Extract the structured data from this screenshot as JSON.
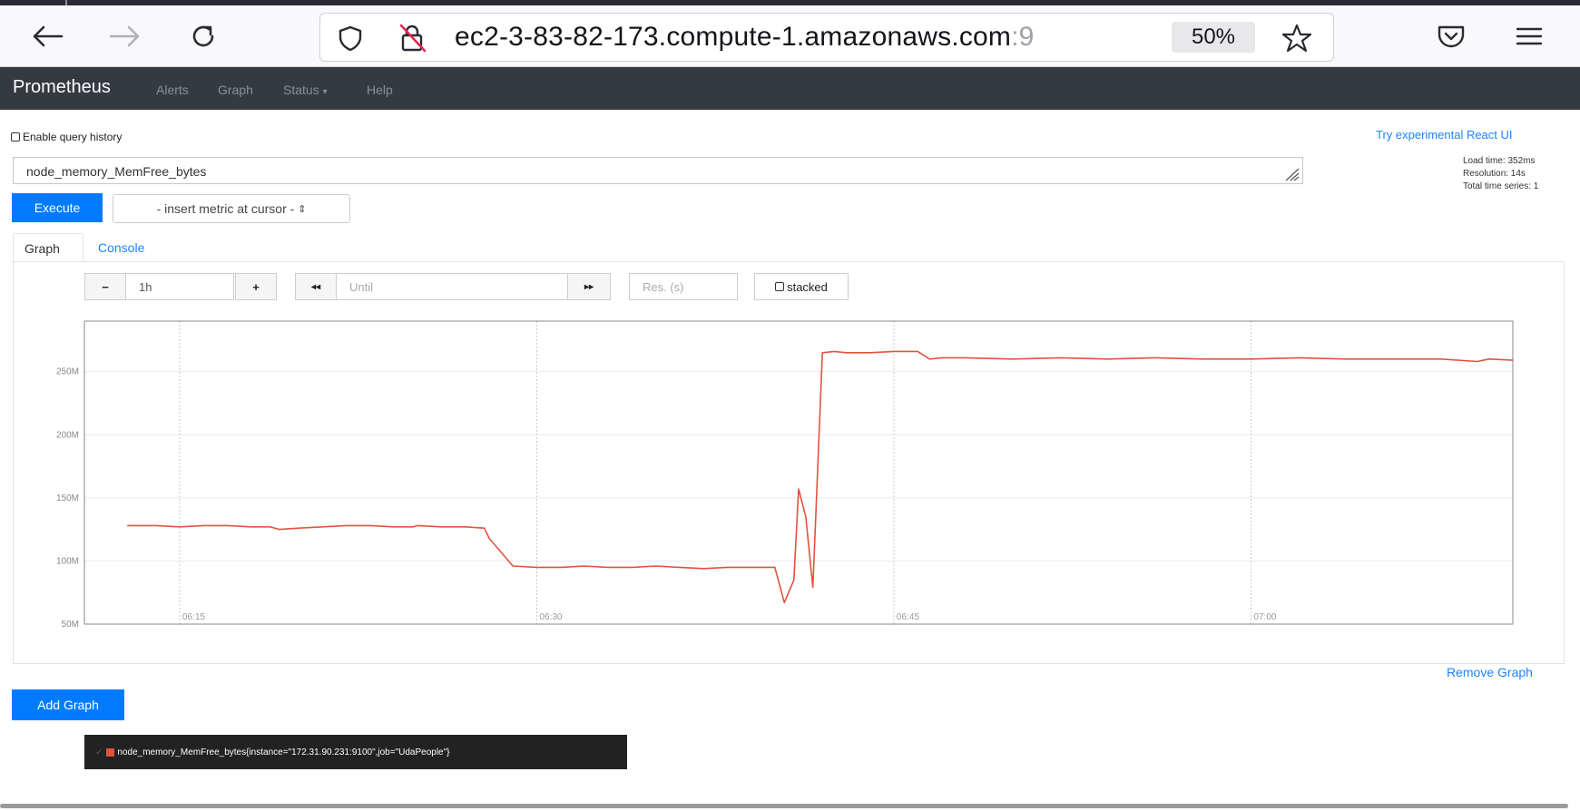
{
  "browser": {
    "url_main": "ec2-3-83-82-173.compute-1.amazonaws.com",
    "url_faded": ":9",
    "zoom": "50%"
  },
  "navbar": {
    "brand": "Prometheus",
    "links": [
      "Alerts",
      "Graph",
      "Status",
      "Help"
    ],
    "status_caret": "▾"
  },
  "page": {
    "enable_history": "Enable query history",
    "react_ui_link": "Try experimental React UI",
    "expression": "node_memory_MemFree_bytes",
    "execute": "Execute",
    "insert_metric": "- insert metric at cursor -",
    "select_arrows": "⇕",
    "stats": {
      "load_time": "Load time: 352ms",
      "resolution": "Resolution: 14s",
      "total_series": "Total time series: 1"
    },
    "tabs": [
      "Graph",
      "Console"
    ],
    "controls": {
      "minus": "−",
      "range": "1h",
      "plus": "+",
      "back": "◂◂",
      "until_placeholder": "Until",
      "forward": "▸▸",
      "res_placeholder": "Res. (s)",
      "stacked": "stacked"
    },
    "legend_check": "✓",
    "remove_graph": "Remove Graph",
    "add_graph": "Add Graph"
  },
  "colors": {
    "accent": "#007bff",
    "series": "#e0533e",
    "navbar": "#343a40"
  },
  "chart_data": {
    "type": "line",
    "ylim": [
      50,
      290
    ],
    "yticks": [
      50,
      100,
      150,
      200,
      250
    ],
    "ytick_labels": [
      "50M",
      "100M",
      "150M",
      "200M",
      "250M"
    ],
    "xlim": [
      11,
      71
    ],
    "xticks": [
      15,
      30,
      45,
      60
    ],
    "xtick_labels": [
      "06:15",
      "06:30",
      "06:45",
      "07:00"
    ],
    "series": [
      {
        "name": "node_memory_MemFree_bytes{instance=\"172.31.90.231:9100\",job=\"UdaPeople\"}",
        "x": [
          12.8,
          14,
          15,
          16,
          17,
          18,
          18.8,
          19.2,
          20,
          21,
          22,
          23,
          24,
          24.8,
          25,
          26,
          27,
          27.8,
          28,
          29,
          30,
          31,
          32,
          33,
          34,
          35,
          36,
          37,
          38,
          39,
          40,
          40.4,
          40.8,
          41,
          41.3,
          41.6,
          42,
          42.5,
          43,
          44,
          45,
          46,
          46.5,
          47,
          48,
          50,
          52,
          54,
          56,
          58,
          60,
          62,
          64,
          66,
          68,
          69.5,
          70,
          71
        ],
        "values": [
          128,
          128,
          127,
          128,
          128,
          127,
          127,
          125,
          126,
          127,
          128,
          128,
          127,
          127,
          128,
          127,
          127,
          126,
          118,
          96,
          95,
          95,
          96,
          95,
          95,
          96,
          95,
          94,
          95,
          95,
          95,
          67,
          85,
          157,
          135,
          79,
          265,
          266,
          265,
          265,
          266,
          266,
          260,
          261,
          261,
          260,
          261,
          260,
          261,
          260,
          260,
          261,
          260,
          260,
          260,
          258,
          260,
          259
        ]
      }
    ]
  }
}
